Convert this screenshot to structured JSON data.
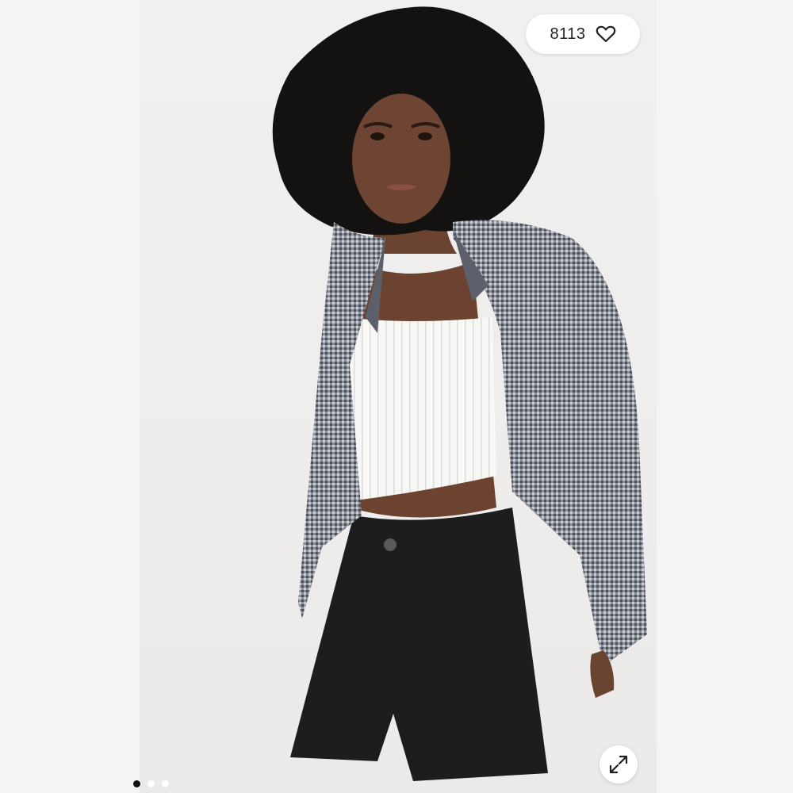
{
  "listing": {
    "like_count": "8113",
    "like_icon": "heart-outline-icon",
    "expand_icon": "expand-arrows-icon",
    "carousel": {
      "total_slides": 3,
      "active_index": 0
    }
  },
  "colors": {
    "backdrop": "#f4f4f4",
    "photo_background": "#eeedec",
    "pill_background": "#ffffff",
    "text_primary": "#222222",
    "dot_active": "#111111",
    "dot_inactive": "#ffffff"
  }
}
